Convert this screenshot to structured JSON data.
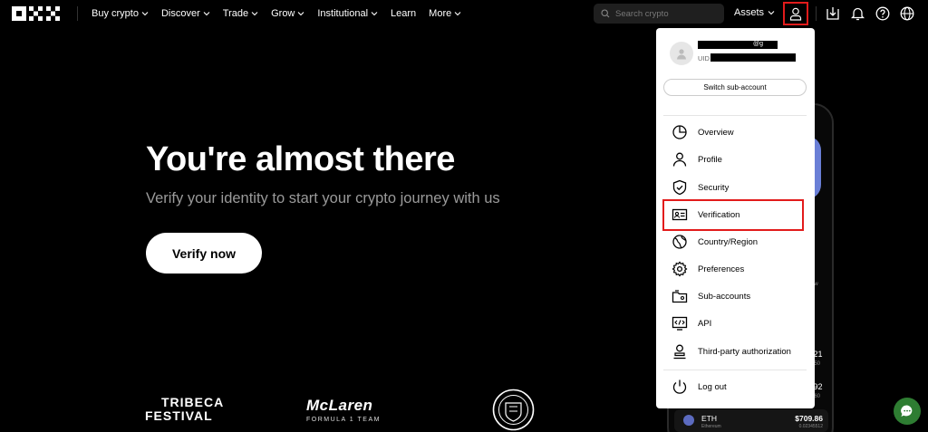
{
  "nav": {
    "logo": "OKX",
    "items": [
      {
        "label": "Buy crypto",
        "has_dropdown": true
      },
      {
        "label": "Discover",
        "has_dropdown": true
      },
      {
        "label": "Trade",
        "has_dropdown": true
      },
      {
        "label": "Grow",
        "has_dropdown": true
      },
      {
        "label": "Institutional",
        "has_dropdown": true
      },
      {
        "label": "Learn",
        "has_dropdown": false
      },
      {
        "label": "More",
        "has_dropdown": true
      }
    ],
    "search_placeholder": "Search crypto",
    "assets_label": "Assets",
    "icons": [
      "user-icon",
      "download-icon",
      "bell-icon",
      "help-icon",
      "globe-icon"
    ]
  },
  "hero": {
    "title": "You're almost there",
    "subtitle": "Verify your identity to start your crypto journey with us",
    "cta": "Verify now"
  },
  "partners": {
    "tribeca_line1": "TRIBECA",
    "tribeca_line2": "FESTIVAL",
    "mclaren": "McLaren",
    "mclaren_sub": "FORMULA 1 TEAM",
    "mancity": "MANCHESTER CITY"
  },
  "account_menu": {
    "email_fragment": "@g",
    "uid_label": "UID",
    "switch_label": "Switch sub-account",
    "items": [
      {
        "label": "Overview",
        "icon": "pie-chart-icon"
      },
      {
        "label": "Profile",
        "icon": "person-icon"
      },
      {
        "label": "Security",
        "icon": "shield-icon"
      },
      {
        "label": "Verification",
        "icon": "id-card-icon"
      },
      {
        "label": "Country/Region",
        "icon": "globe-icon"
      },
      {
        "label": "Preferences",
        "icon": "gear-icon"
      },
      {
        "label": "Sub-accounts",
        "icon": "sub-accounts-icon"
      },
      {
        "label": "API",
        "icon": "api-icon"
      },
      {
        "label": "Third-party authorization",
        "icon": "authorization-icon"
      }
    ],
    "logout_label": "Log out"
  },
  "phone_mockup": {
    "row1_value": ".21",
    "row2_value": ".92",
    "row3_value": "950",
    "row4_value": "960",
    "partial_label": "aw",
    "asset_symbol": "ETH",
    "asset_name": "Ethereum",
    "asset_price": "$709.86",
    "asset_amount": "0.02345512"
  },
  "colors": {
    "background": "#000000",
    "highlight": "#e21b1b",
    "menu_bg": "#ffffff",
    "chat": "#2e7d32"
  }
}
